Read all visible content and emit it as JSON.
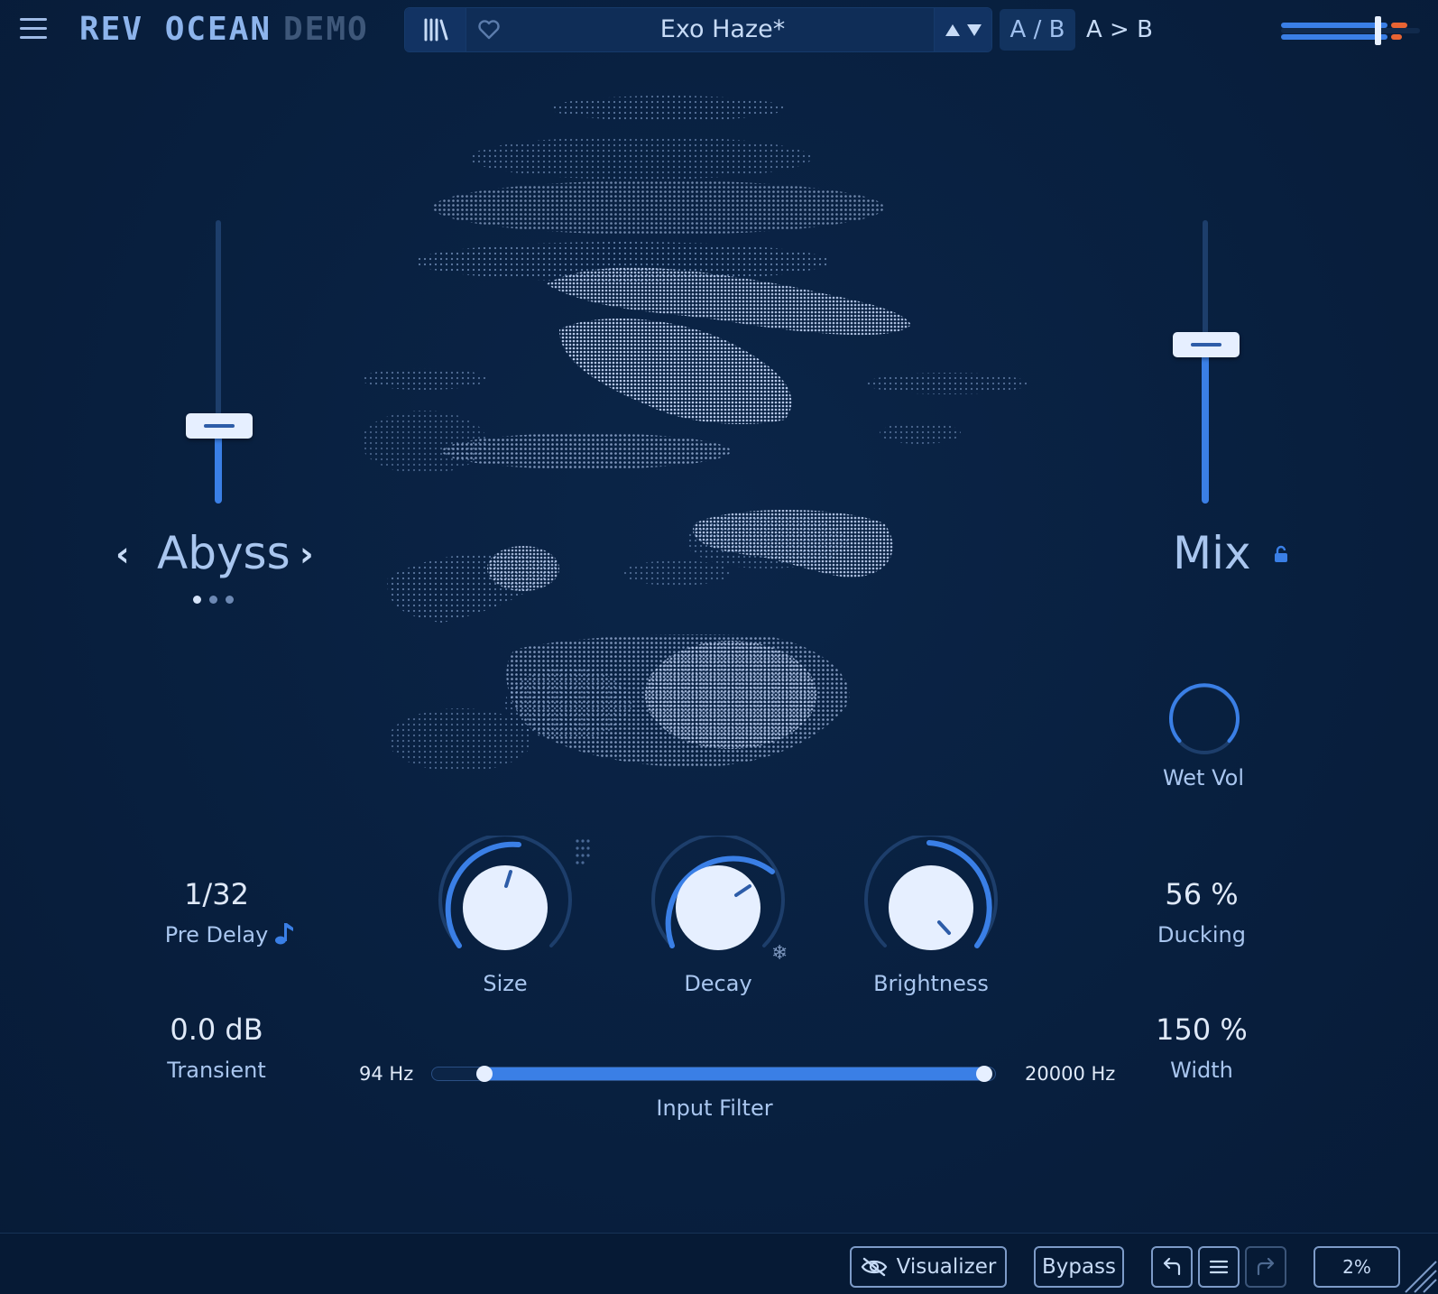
{
  "header": {
    "brand": "REV OCEAN",
    "brand_suffix": "DEMO",
    "preset_name": "Exo Haze*",
    "ab_label": "A / B",
    "ab_copy_label": "A > B"
  },
  "left_panel": {
    "algorithm": "Abyss",
    "algorithm_page_count": 3,
    "algorithm_page_active": 1,
    "pre_delay_value": "1/32",
    "pre_delay_label": "Pre Delay",
    "transient_value": "0.0 dB",
    "transient_label": "Transient"
  },
  "right_panel": {
    "mix_label": "Mix",
    "wet_vol_label": "Wet Vol",
    "ducking_value": "56 %",
    "ducking_label": "Ducking",
    "width_value": "150 %",
    "width_label": "Width"
  },
  "knobs": {
    "size_label": "Size",
    "decay_label": "Decay",
    "brightness_label": "Brightness"
  },
  "input_filter": {
    "label": "Input Filter",
    "low_value": "94 Hz",
    "high_value": "20000 Hz"
  },
  "footer": {
    "visualizer_label": "Visualizer",
    "bypass_label": "Bypass",
    "zoom_value": "2%"
  },
  "icons": {
    "menu": "hamburger-icon",
    "library": "library-icon",
    "favorite": "heart-icon",
    "tempo_sync": "note-icon",
    "freeze": "snowflake-icon",
    "lock": "lock-icon",
    "visualizer": "eye-off-icon",
    "undo": "undo-icon",
    "history": "list-icon",
    "redo": "redo-icon",
    "resize": "resize-grip-icon"
  },
  "colors": {
    "background": "#081f3e",
    "accent": "#3a7fe6",
    "text": "#a9c6ef",
    "meter_peak": "#e86433"
  }
}
